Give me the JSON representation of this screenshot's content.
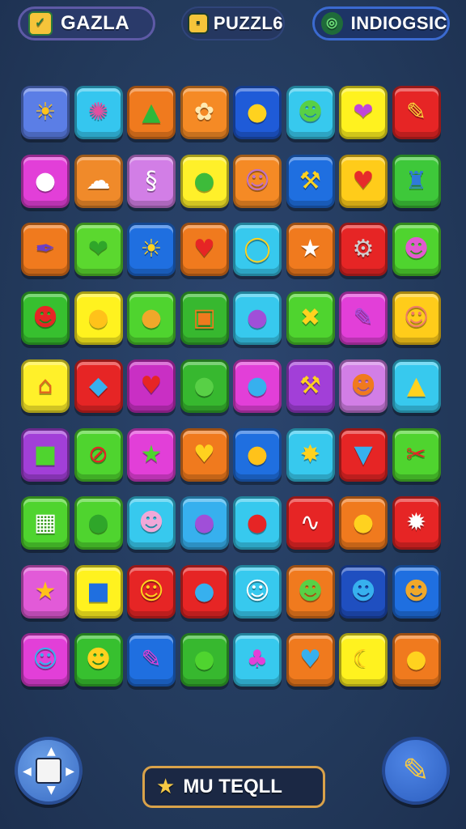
{
  "header": {
    "tabs": [
      {
        "label": "GAZLA",
        "icon": "check-box-icon",
        "glyph": "✓"
      },
      {
        "label": "PUZZL6",
        "icon": "puzzle-box-icon",
        "glyph": "▪"
      },
      {
        "label": "INDIOGSIC",
        "icon": "target-icon",
        "glyph": "◎"
      }
    ]
  },
  "board": {
    "columns": 8,
    "rows": 9,
    "tiles": [
      {
        "color": "#5b7ee6",
        "icon": "sun-icon",
        "glyph": "☀",
        "fg": "#ffc21a"
      },
      {
        "color": "#35c6ef",
        "icon": "sun-flower-icon",
        "glyph": "✺",
        "fg": "#e24fa0"
      },
      {
        "color": "#f07a1e",
        "icon": "green-shape-icon",
        "glyph": "▲",
        "fg": "#2fb83a"
      },
      {
        "color": "#f58a25",
        "icon": "flower-icon",
        "glyph": "✿",
        "fg": "#ffe9b0"
      },
      {
        "color": "#1f5bd8",
        "icon": "speech-icon",
        "glyph": "●",
        "fg": "#ffd21f"
      },
      {
        "color": "#37c9ee",
        "icon": "monster-icon",
        "glyph": "☻",
        "fg": "#58d046"
      },
      {
        "color": "#fff21f",
        "icon": "leaf-icon",
        "glyph": "❤",
        "fg": "#c046d8"
      },
      {
        "color": "#e62525",
        "icon": "pencil-icon",
        "glyph": "✎",
        "fg": "#ffd43a"
      },
      {
        "color": "#e23fd8",
        "icon": "egg-icon",
        "glyph": "●",
        "fg": "#ffffff"
      },
      {
        "color": "#f08a2a",
        "icon": "ghost-icon",
        "glyph": "☁",
        "fg": "#ffffff"
      },
      {
        "color": "#d27ee6",
        "icon": "swirl-icon",
        "glyph": "§",
        "fg": "#ffffff"
      },
      {
        "color": "#fff02a",
        "icon": "pepper-icon",
        "glyph": "●",
        "fg": "#3dbb3a"
      },
      {
        "color": "#f58a25",
        "icon": "face-icon",
        "glyph": "☺",
        "fg": "#c072c8"
      },
      {
        "color": "#1f6fe0",
        "icon": "hammer-icon",
        "glyph": "⚒",
        "fg": "#ffd21f"
      },
      {
        "color": "#ffcc1a",
        "icon": "heart-icon",
        "glyph": "♥",
        "fg": "#e62b2b"
      },
      {
        "color": "#3ec83a",
        "icon": "bottle-icon",
        "glyph": "♜",
        "fg": "#2f7ad8"
      },
      {
        "color": "#f07a1e",
        "icon": "feather-icon",
        "glyph": "✒",
        "fg": "#6a3fc6"
      },
      {
        "color": "#5bd82f",
        "icon": "leaf-icon",
        "glyph": "❤",
        "fg": "#2fa62a"
      },
      {
        "color": "#1f6fe0",
        "icon": "sun-icon",
        "glyph": "☀",
        "fg": "#ffd21f"
      },
      {
        "color": "#f07a1e",
        "icon": "heart-icon",
        "glyph": "♥",
        "fg": "#e62525"
      },
      {
        "color": "#37c9ee",
        "icon": "ring-icon",
        "glyph": "◯",
        "fg": "#ffd21f"
      },
      {
        "color": "#f07a1e",
        "icon": "star-icon",
        "glyph": "★",
        "fg": "#ffffff"
      },
      {
        "color": "#e62525",
        "icon": "tool-icon",
        "glyph": "⚙",
        "fg": "#cfcfcf"
      },
      {
        "color": "#4fd42f",
        "icon": "blob-icon",
        "glyph": "☻",
        "fg": "#e25ad0"
      },
      {
        "color": "#37c02f",
        "icon": "bug-icon",
        "glyph": "☻",
        "fg": "#e62525"
      },
      {
        "color": "#fff21f",
        "icon": "lemon-icon",
        "glyph": "●",
        "fg": "#ffc21a"
      },
      {
        "color": "#4fd42f",
        "icon": "bread-icon",
        "glyph": "●",
        "fg": "#f0a82a"
      },
      {
        "color": "#37b82f",
        "icon": "screen-icon",
        "glyph": "▣",
        "fg": "#f07a1e"
      },
      {
        "color": "#37c9ee",
        "icon": "ball-icon",
        "glyph": "●",
        "fg": "#a04fd8"
      },
      {
        "color": "#4fd42f",
        "icon": "cross-tools-icon",
        "glyph": "✖",
        "fg": "#ffd21f"
      },
      {
        "color": "#e23fd8",
        "icon": "pencil-icon",
        "glyph": "✎",
        "fg": "#a04fd8"
      },
      {
        "color": "#ffcc1a",
        "icon": "face-icon",
        "glyph": "☺",
        "fg": "#f07a6a"
      },
      {
        "color": "#fff02a",
        "icon": "house-icon",
        "glyph": "⌂",
        "fg": "#e0681e"
      },
      {
        "color": "#e62525",
        "icon": "cube-icon",
        "glyph": "◆",
        "fg": "#37b0ee"
      },
      {
        "color": "#c92fc4",
        "icon": "heart-icon",
        "glyph": "♥",
        "fg": "#e62525"
      },
      {
        "color": "#37b82f",
        "icon": "leaf-icon",
        "glyph": "●",
        "fg": "#58d046"
      },
      {
        "color": "#e23fd8",
        "icon": "balloon-icon",
        "glyph": "●",
        "fg": "#37b0ee"
      },
      {
        "color": "#a23fd8",
        "icon": "hammer-icon",
        "glyph": "⚒",
        "fg": "#ffd21f"
      },
      {
        "color": "#d27ee6",
        "icon": "robot-icon",
        "glyph": "☻",
        "fg": "#f07a1e"
      },
      {
        "color": "#37c9ee",
        "icon": "cheese-icon",
        "glyph": "▲",
        "fg": "#ffd21f"
      },
      {
        "color": "#a23fd8",
        "icon": "block-icon",
        "glyph": "■",
        "fg": "#4fd42f"
      },
      {
        "color": "#4fd42f",
        "icon": "no-sign-icon",
        "glyph": "⊘",
        "fg": "#e62525"
      },
      {
        "color": "#e23fd8",
        "icon": "star-icon",
        "glyph": "★",
        "fg": "#4fd42f"
      },
      {
        "color": "#f07a1e",
        "icon": "heart-icon",
        "glyph": "♥",
        "fg": "#ffd21f"
      },
      {
        "color": "#1f6fe0",
        "icon": "lemon-icon",
        "glyph": "●",
        "fg": "#ffc21a"
      },
      {
        "color": "#37c9ee",
        "icon": "star-blob-icon",
        "glyph": "✸",
        "fg": "#ffd21f"
      },
      {
        "color": "#e62525",
        "icon": "carrot-icon",
        "glyph": "▼",
        "fg": "#37b0ee"
      },
      {
        "color": "#4fd42f",
        "icon": "scissors-icon",
        "glyph": "✂",
        "fg": "#e62525"
      },
      {
        "color": "#4fd42f",
        "icon": "calculator-icon",
        "glyph": "▦",
        "fg": "#ffffff"
      },
      {
        "color": "#4fd42f",
        "icon": "leaf-icon",
        "glyph": "●",
        "fg": "#2fa62a"
      },
      {
        "color": "#37c9ee",
        "icon": "bunny-icon",
        "glyph": "☻",
        "fg": "#f0a8d8"
      },
      {
        "color": "#37b0ee",
        "icon": "blob-icon",
        "glyph": "●",
        "fg": "#a04fd8"
      },
      {
        "color": "#37c9ee",
        "icon": "lollipop-icon",
        "glyph": "●",
        "fg": "#e62525"
      },
      {
        "color": "#e62525",
        "icon": "scribble-icon",
        "glyph": "∿",
        "fg": "#ffffff"
      },
      {
        "color": "#f07a1e",
        "icon": "thumb-icon",
        "glyph": "●",
        "fg": "#ffd21f"
      },
      {
        "color": "#e62525",
        "icon": "burst-icon",
        "glyph": "✹",
        "fg": "#ffffff"
      },
      {
        "color": "#e25ad8",
        "icon": "star-icon",
        "glyph": "★",
        "fg": "#ffc21a"
      },
      {
        "color": "#fff21f",
        "icon": "box-face-icon",
        "glyph": "■",
        "fg": "#1f6fe0"
      },
      {
        "color": "#e62525",
        "icon": "smiley-icon",
        "glyph": "☺",
        "fg": "#ffd21f"
      },
      {
        "color": "#e62525",
        "icon": "shield-icon",
        "glyph": "●",
        "fg": "#37b0ee"
      },
      {
        "color": "#37c9ee",
        "icon": "cat-face-icon",
        "glyph": "☺",
        "fg": "#ffffff"
      },
      {
        "color": "#f07a1e",
        "icon": "frog-icon",
        "glyph": "☻",
        "fg": "#58d046"
      },
      {
        "color": "#1f4fc0",
        "icon": "alien-icon",
        "glyph": "☻",
        "fg": "#37b0ee"
      },
      {
        "color": "#1f6fe0",
        "icon": "bear-icon",
        "glyph": "☻",
        "fg": "#f0a82a"
      },
      {
        "color": "#e23fd8",
        "icon": "smiley-icon",
        "glyph": "☺",
        "fg": "#37b0ee"
      },
      {
        "color": "#37c02f",
        "icon": "duck-icon",
        "glyph": "☻",
        "fg": "#ffd21f"
      },
      {
        "color": "#1f6fe0",
        "icon": "pencil-icon",
        "glyph": "✎",
        "fg": "#e23fd8"
      },
      {
        "color": "#37b82f",
        "icon": "leaf-icon",
        "glyph": "●",
        "fg": "#4fd42f"
      },
      {
        "color": "#37c9ee",
        "icon": "mushroom-icon",
        "glyph": "♣",
        "fg": "#e23fd8"
      },
      {
        "color": "#f07a1e",
        "icon": "heart-icon",
        "glyph": "♥",
        "fg": "#37b0ee"
      },
      {
        "color": "#fff21f",
        "icon": "banana-icon",
        "glyph": "☾",
        "fg": "#ffc21a"
      },
      {
        "color": "#f07a1e",
        "icon": "lemon-icon",
        "glyph": "●",
        "fg": "#ffd21f"
      }
    ]
  },
  "footer": {
    "dpad_icon": "dpad-icon",
    "center_label": "MU TEQLL",
    "center_icon": "star-hand-icon",
    "center_glyph": "★",
    "edit_icon": "pencil-icon",
    "edit_glyph": "✎"
  }
}
